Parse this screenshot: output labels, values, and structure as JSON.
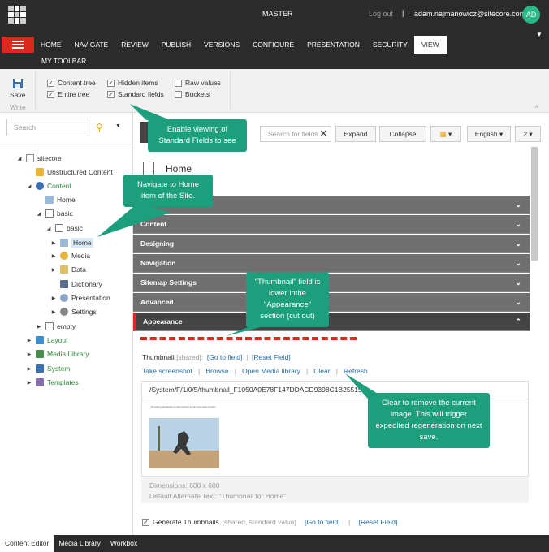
{
  "header": {
    "title": "MASTER",
    "logout": "Log out",
    "separator": "|",
    "user": "adam.najmanowicz@sitecore.com",
    "avatar_initials": "AD"
  },
  "menu": {
    "tabs": [
      "HOME",
      "NAVIGATE",
      "REVIEW",
      "PUBLISH",
      "VERSIONS",
      "CONFIGURE",
      "PRESENTATION",
      "SECURITY",
      "VIEW"
    ],
    "active_tab": "VIEW",
    "my_toolbar": "MY TOOLBAR"
  },
  "ribbon": {
    "save": "Save",
    "write": "Write",
    "checkboxes": [
      {
        "label": "Content tree",
        "checked": true
      },
      {
        "label": "Entire tree",
        "checked": true
      },
      {
        "label": "Hidden items",
        "checked": true
      },
      {
        "label": "Standard fields",
        "checked": true
      },
      {
        "label": "Raw values",
        "checked": false
      },
      {
        "label": "Buckets",
        "checked": false
      }
    ]
  },
  "tree": {
    "search_placeholder": "Search",
    "nodes": [
      "sitecore",
      "Unstructured Content",
      "Content",
      "Home",
      "basic",
      "basic",
      "Home",
      "Media",
      "Data",
      "Dictionary",
      "Presentation",
      "Settings",
      "empty",
      "Layout",
      "Media Library",
      "System",
      "Templates"
    ]
  },
  "editor": {
    "search_placeholder": "Search for fields",
    "expand": "Expand",
    "collapse": "Collapse",
    "language": "English",
    "version": "2",
    "item_title": "Home",
    "sections": [
      "Content",
      "Designing",
      "Navigation",
      "Sitemap Settings",
      "Advanced",
      "Appearance"
    ]
  },
  "thumbnail": {
    "label": "Thumbnail",
    "shared": "[shared]:",
    "goto": "[Go to field]",
    "reset": "[Reset Field]",
    "actions": [
      "Take screenshot",
      "Browse",
      "Open Media library",
      "Clear",
      "Refresh"
    ],
    "path": "/System/F/1/0/5/thumbnail_F1050A0E78F147DDACD9398C1B255198",
    "dimensions": "Dimensions: 600 x 600",
    "alt_text": "Default Alternate Text: \"Thumbnail for Home\"",
    "preview_caption": "Providing wholesale product basics to the best skate brands"
  },
  "generate": {
    "label": "Generate Thumbnails",
    "meta": "[shared, standard value]",
    "goto": "[Go to field]",
    "reset": "[Reset Field]",
    "checked": true
  },
  "callouts": {
    "standard_fields": "Enable viewing of Standard Fields to see",
    "navigate_home": "Navigate to Home item of the Site.",
    "thumbnail_field": "\"Thumbnail\" field is lower inthe \"Appearance\" section (cut out)",
    "clear": "Clear to remove the current image. This will trigger expedited regeneration on next save."
  },
  "bottom_tabs": [
    "Content Editor",
    "Media Library",
    "Workbox"
  ],
  "colors": {
    "accent": "#dc291e",
    "callout": "#1d9e7c",
    "dark_bar": "#2b2b2b",
    "link": "#2a6ea6"
  }
}
